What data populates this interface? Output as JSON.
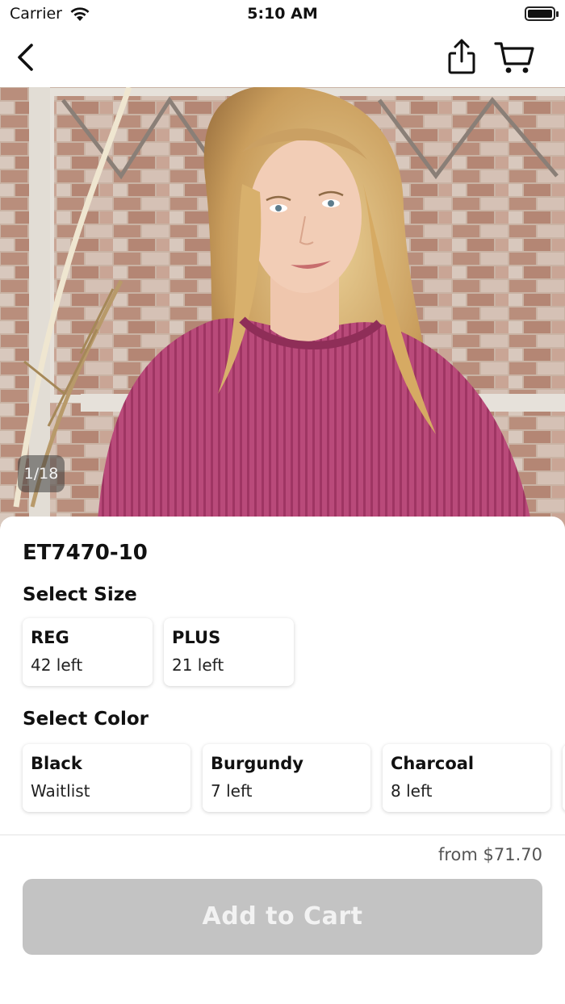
{
  "status_bar": {
    "carrier": "Carrier",
    "time": "5:10 AM"
  },
  "nav": {
    "back_icon": "chevron-left-icon",
    "share_icon": "share-icon",
    "cart_icon": "cart-icon"
  },
  "gallery": {
    "counter": "1/18"
  },
  "product": {
    "code": "ET7470-10",
    "size_title": "Select Size",
    "sizes": [
      {
        "name": "REG",
        "stock": "42 left"
      },
      {
        "name": "PLUS",
        "stock": "21 left"
      }
    ],
    "color_title": "Select Color",
    "colors": [
      {
        "name": "Black",
        "stock": "Waitlist"
      },
      {
        "name": "Burgundy",
        "stock": "7 left"
      },
      {
        "name": "Charcoal",
        "stock": "8 left"
      }
    ]
  },
  "checkout": {
    "price": "from $71.70",
    "add_to_cart": "Add to Cart"
  },
  "colors": {
    "button_disabled": "#c3c3c3",
    "sweater": "#b94a7a"
  }
}
